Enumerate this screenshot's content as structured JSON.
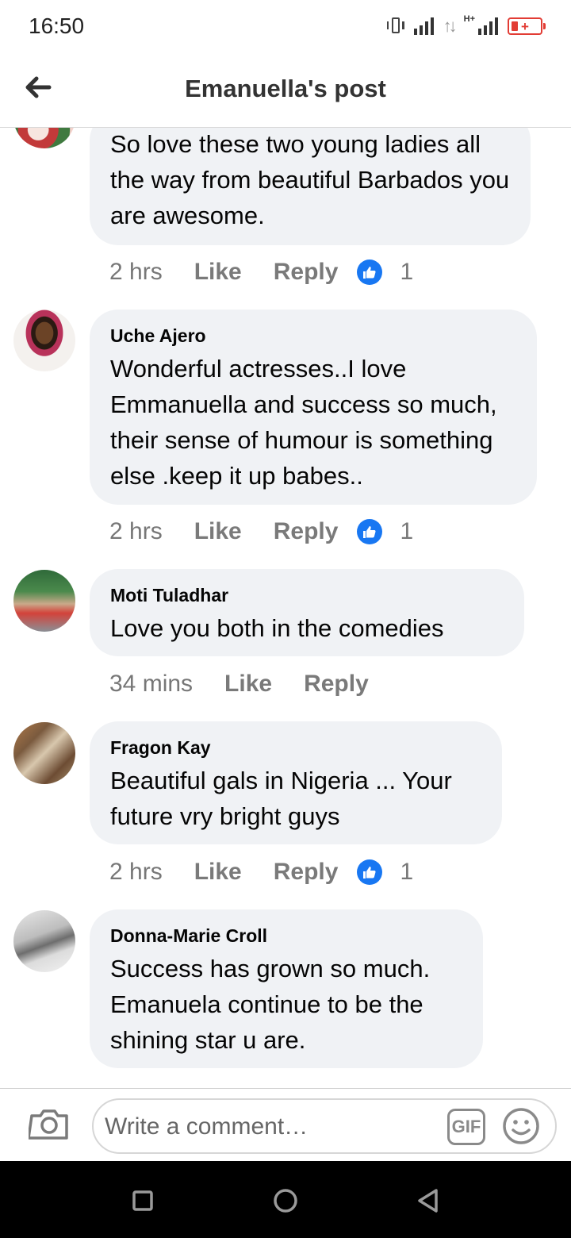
{
  "status_bar": {
    "time": "16:50",
    "network_label": "H+",
    "icons": [
      "vibrate-icon",
      "signal-icon",
      "data-arrows-icon",
      "signal-h-plus-icon",
      "battery-icon"
    ],
    "battery_color": "#e23c34"
  },
  "header": {
    "title": "Emanuella's post",
    "back_icon": "back-arrow-icon"
  },
  "comments": [
    {
      "author": "",
      "text": "So love these two young ladies all the way from beautiful Barbados you are awesome.",
      "time": "2 hrs",
      "like_label": "Like",
      "reply_label": "Reply",
      "reaction_count": "1"
    },
    {
      "author": "Uche Ajero",
      "text": "Wonderful actresses..I love Emmanuella  and success so much, their sense of humour is something else .keep it up babes..",
      "time": "2 hrs",
      "like_label": "Like",
      "reply_label": "Reply",
      "reaction_count": "1"
    },
    {
      "author": "Moti Tuladhar",
      "text": "Love  you  both  in  the  comedies",
      "time": "34 mins",
      "like_label": "Like",
      "reply_label": "Reply",
      "reaction_count": ""
    },
    {
      "author": "Fragon Kay",
      "text": "Beautiful gals in Nigeria ... Your future vry bright guys",
      "time": "2 hrs",
      "like_label": "Like",
      "reply_label": "Reply",
      "reaction_count": "1"
    },
    {
      "author": "Donna-Marie Croll",
      "text": "Success has grown so much. Emanuela continue to be the shining star  u are.",
      "time": "",
      "like_label": "",
      "reply_label": "",
      "reaction_count": ""
    }
  ],
  "composer": {
    "placeholder": "Write a comment…",
    "gif_label": "GIF",
    "camera_icon": "camera-icon",
    "emoji_icon": "emoji-icon"
  },
  "navbar": {
    "icons": [
      "recent-apps-icon",
      "home-icon",
      "back-icon"
    ]
  },
  "colors": {
    "like_blue": "#1877f2",
    "bubble_bg": "#f0f2f5",
    "meta_gray": "#777777"
  }
}
